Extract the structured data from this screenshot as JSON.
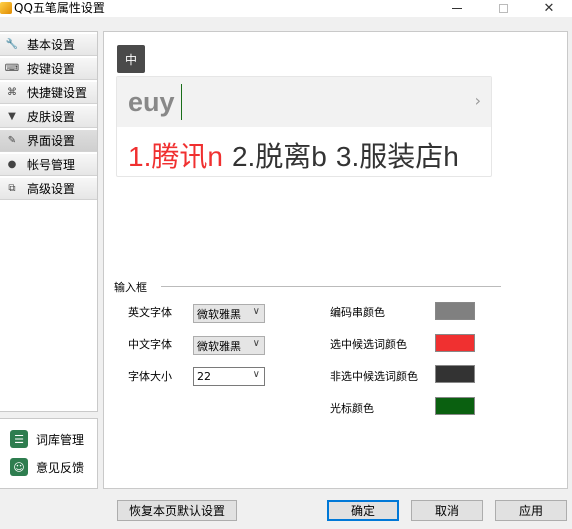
{
  "window": {
    "title": "QQ五笔属性设置",
    "controls": {
      "minimize": "–",
      "maximize": "□",
      "close": "✕"
    }
  },
  "sidebar": {
    "items": [
      {
        "label": "基本设置",
        "icon": "wrench-icon",
        "glyph": "🔧"
      },
      {
        "label": "按键设置",
        "icon": "keyboard-icon",
        "glyph": "⌨"
      },
      {
        "label": "快捷键设置",
        "icon": "shortcut-icon",
        "glyph": "⌘"
      },
      {
        "label": "皮肤设置",
        "icon": "shirt-icon",
        "glyph": "👕"
      },
      {
        "label": "界面设置",
        "icon": "edit-icon",
        "glyph": "✎",
        "active": true
      },
      {
        "label": "帐号管理",
        "icon": "user-icon",
        "glyph": "👤"
      },
      {
        "label": "高级设置",
        "icon": "copy-icon",
        "glyph": "⧉"
      }
    ],
    "bottom": {
      "dictionary": "词库管理",
      "feedback": "意见反馈"
    }
  },
  "preview": {
    "mode_badge": "中",
    "code": "euy",
    "candidates": [
      "1.腾讯n",
      "2.脱离b",
      "3.服装店h"
    ],
    "arrow": "›"
  },
  "input_box": {
    "section_title": "输入框",
    "english_font_label": "英文字体",
    "english_font_value": "微软雅黑",
    "chinese_font_label": "中文字体",
    "chinese_font_value": "微软雅黑",
    "font_size_label": "字体大小",
    "font_size_value": "22",
    "code_color_label": "编码串颜色",
    "selected_color_label": "选中候选词颜色",
    "unselected_color_label": "非选中候选词颜色",
    "cursor_color_label": "光标颜色"
  },
  "colors": {
    "code_color": "#808080",
    "selected_color": "#f03030",
    "unselected_color": "#333333",
    "cursor_color": "#0a6010"
  },
  "buttons": {
    "restore_defaults": "恢复本页默认设置",
    "ok": "确定",
    "cancel": "取消",
    "apply": "应用"
  }
}
